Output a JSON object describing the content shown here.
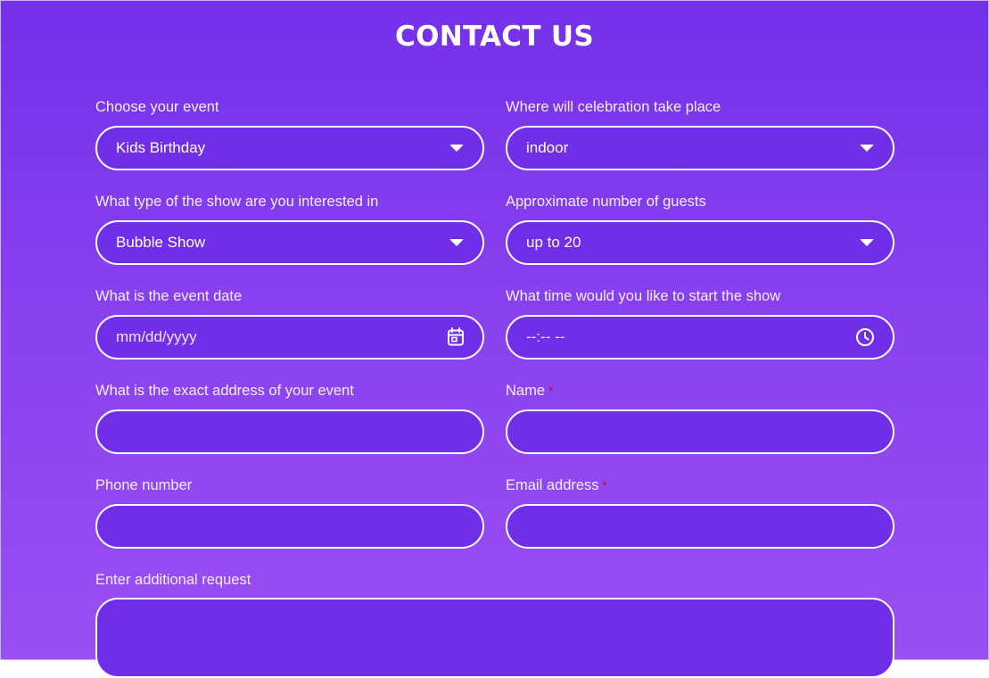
{
  "title": "CONTACT US",
  "form": {
    "event_type": {
      "label": "Choose your event",
      "value": "Kids Birthday"
    },
    "location": {
      "label": "Where will celebration take place",
      "value": "indoor"
    },
    "show_type": {
      "label": "What type of the show are you interested in",
      "value": "Bubble Show"
    },
    "guests": {
      "label": "Approximate number of guests",
      "value": "up to 20"
    },
    "event_date": {
      "label": "What is the event date",
      "placeholder": "mm/dd/yyyy"
    },
    "start_time": {
      "label": "What time would you like to start the show",
      "placeholder": "--:-- --"
    },
    "address": {
      "label": "What is the exact address of your event",
      "value": ""
    },
    "name": {
      "label": "Name",
      "required_mark": "*",
      "value": ""
    },
    "phone": {
      "label": "Phone number",
      "value": ""
    },
    "email": {
      "label": "Email address",
      "required_mark": "*",
      "value": ""
    },
    "additional_request": {
      "label": "Enter additional request",
      "value": ""
    }
  },
  "icons": {
    "select": "chevron-down-icon",
    "date": "calendar-icon",
    "time": "clock-icon"
  },
  "colors": {
    "background_top": "#7430ea",
    "background_bottom": "#9a4ff3",
    "field_fill": "#712ee8",
    "field_border": "#ffffff",
    "required_mark": "#b8123c"
  }
}
